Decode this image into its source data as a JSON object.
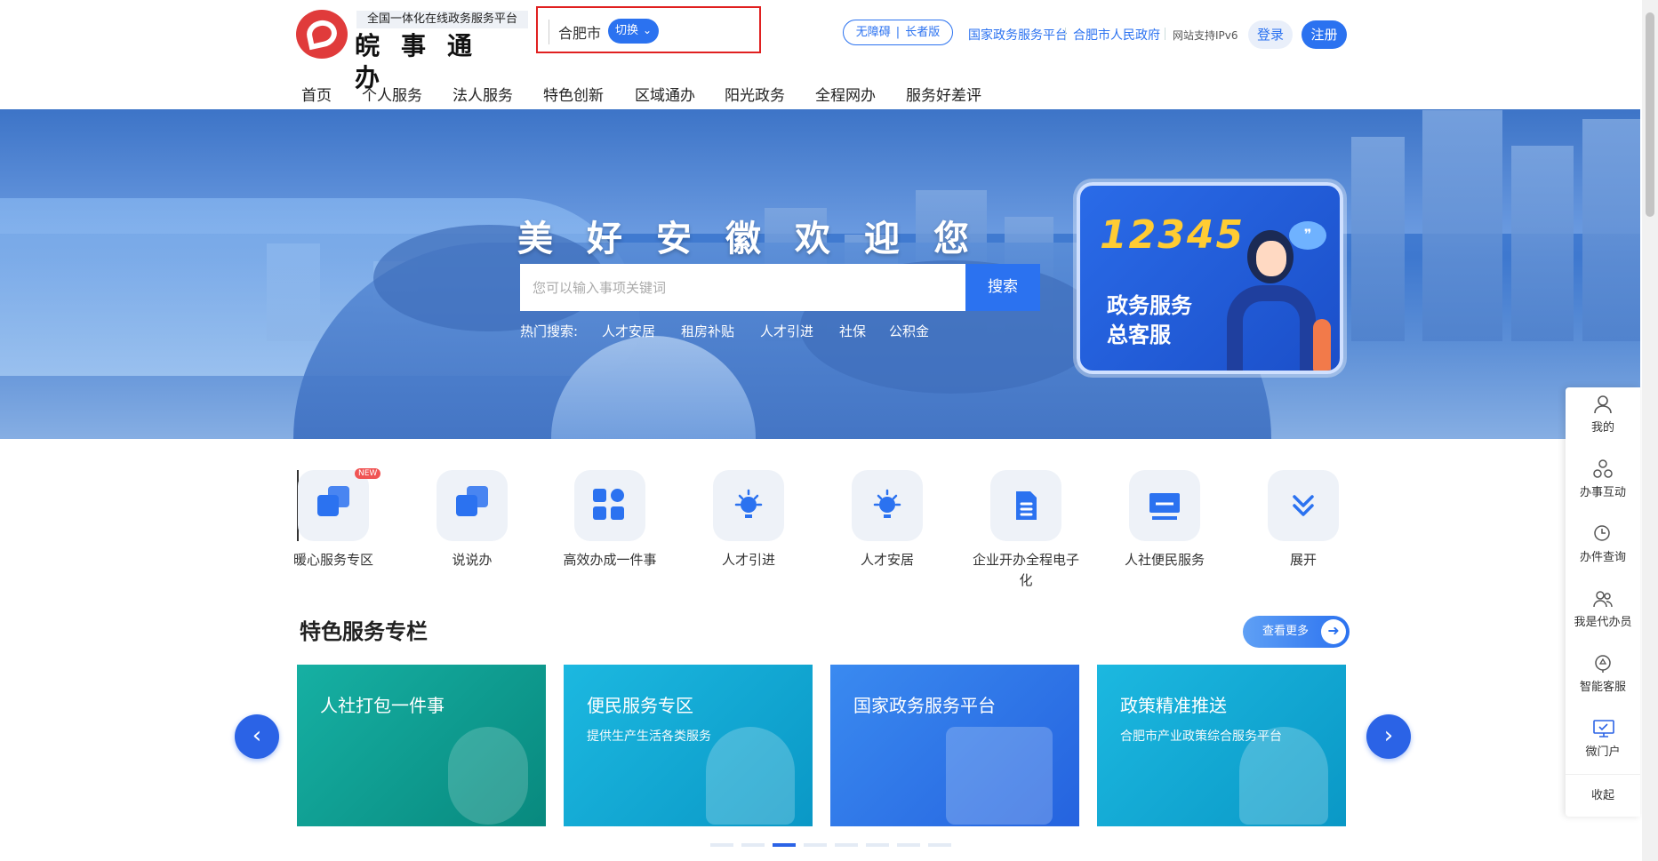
{
  "header": {
    "platform_tagline": "全国一体化在线政务服务平台",
    "brand_name": "皖事通办",
    "city": "合肥市",
    "switch_label": "切换",
    "accessibility": [
      "无障碍",
      "长者版"
    ],
    "links": [
      "国家政务服务平台",
      "合肥市人民政府"
    ],
    "ipv6_note": "网站支持IPv6",
    "login_label": "登录",
    "register_label": "注册"
  },
  "nav": [
    "首页",
    "个人服务",
    "法人服务",
    "特色创新",
    "区域通办",
    "阳光政务",
    "全程网办",
    "服务好差评"
  ],
  "banner": {
    "welcome": "美好安徽欢迎您",
    "search_placeholder": "您可以输入事项关键词",
    "search_button": "搜索",
    "hot_label": "热门搜索:",
    "hot_items": [
      "人才安居",
      "租房补贴",
      "人才引进",
      "社保",
      "公积金"
    ],
    "hotline": {
      "number": "12345",
      "line1": "政务服务",
      "line2": "总客服"
    }
  },
  "quick_services": [
    {
      "label": "暖心服务专区",
      "icon": "squares-icon",
      "badge": "NEW"
    },
    {
      "label": "说说办",
      "icon": "squares-icon"
    },
    {
      "label": "高效办成一件事",
      "icon": "grid-icon"
    },
    {
      "label": "人才引进",
      "icon": "bulb-icon"
    },
    {
      "label": "人才安居",
      "icon": "bulb-icon"
    },
    {
      "label": "企业开办全程电子化",
      "icon": "document-icon"
    },
    {
      "label": "人社便民服务",
      "icon": "monitor-icon"
    },
    {
      "label": "展开",
      "icon": "chevron-double-down-icon"
    }
  ],
  "featured": {
    "title": "特色服务专栏",
    "more_label": "查看更多",
    "cards": [
      {
        "title": "人社打包一件事",
        "subtitle": "",
        "color": "#0fa59a"
      },
      {
        "title": "便民服务专区",
        "subtitle": "提供生产生活各类服务",
        "color": "#11a9d3"
      },
      {
        "title": "国家政务服务平台",
        "subtitle": "",
        "color": "#2f7de8"
      },
      {
        "title": "政策精准推送",
        "subtitle": "合肥市产业政策综合服务平台",
        "color": "#11a9d3"
      }
    ],
    "carousel_active_index": 2,
    "carousel_dot_count": 8
  },
  "right_sidebar": {
    "items": [
      {
        "label": "我的",
        "icon": "user-icon"
      },
      {
        "label": "办事互动",
        "icon": "interaction-icon"
      },
      {
        "label": "办件查询",
        "icon": "clock-search-icon"
      },
      {
        "label": "我是代办员",
        "icon": "agents-icon"
      },
      {
        "label": "智能客服",
        "icon": "robot-service-icon"
      },
      {
        "label": "微门户",
        "icon": "monitor-icon"
      }
    ],
    "collapse_label": "收起"
  },
  "colors": {
    "primary": "#2b72f0",
    "highlight_border": "#e02020",
    "logo_red": "#e03b3b"
  }
}
